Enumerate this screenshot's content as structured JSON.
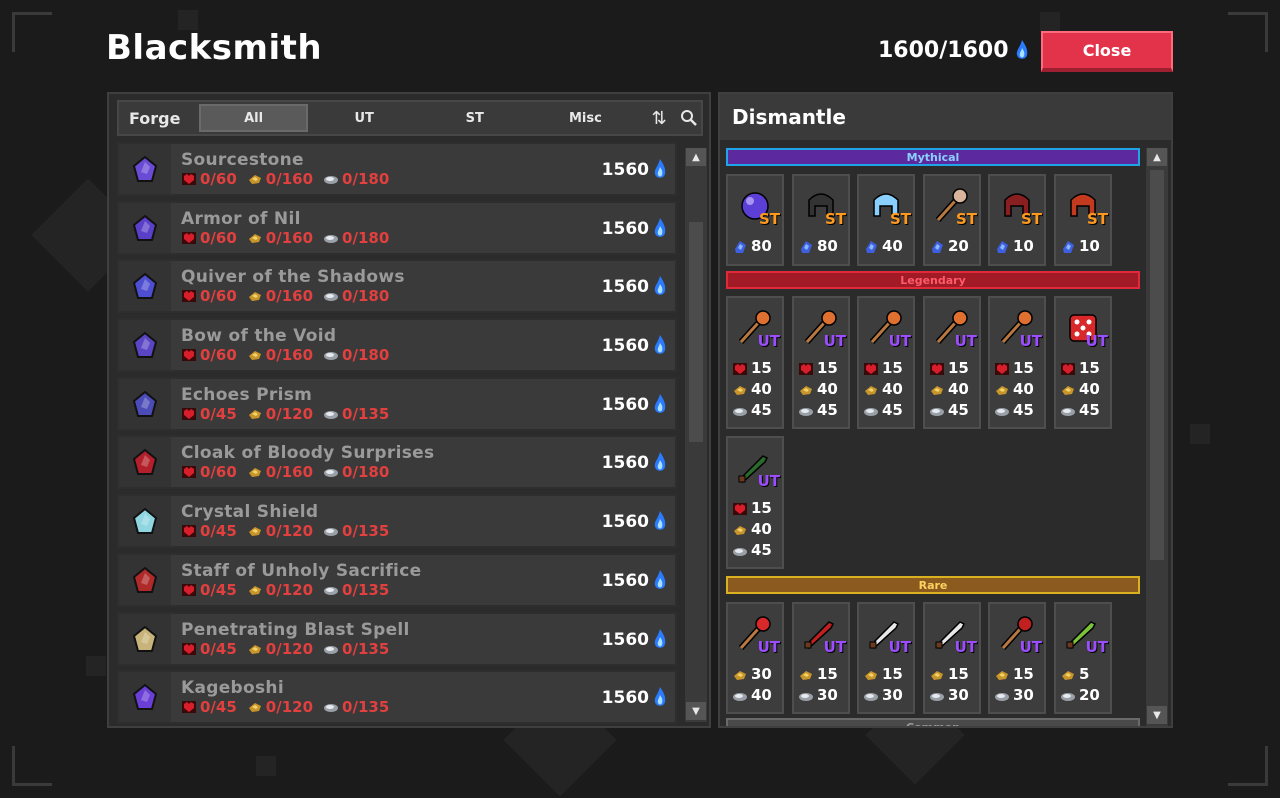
{
  "title": "Blacksmith",
  "essence": {
    "value": "1600/1600"
  },
  "close_label": "Close",
  "forge": {
    "label": "Forge",
    "tabs": [
      {
        "label": "All",
        "active": true
      },
      {
        "label": "UT",
        "active": false
      },
      {
        "label": "ST",
        "active": false
      },
      {
        "label": "Misc",
        "active": false
      }
    ],
    "items": [
      {
        "name": "Sourcestone",
        "c1": "0/60",
        "c2": "0/160",
        "c3": "0/180",
        "price": "1560",
        "icon": "sourcestone-icon",
        "color": "#6a4bd6"
      },
      {
        "name": "Armor of Nil",
        "c1": "0/60",
        "c2": "0/160",
        "c3": "0/180",
        "price": "1560",
        "icon": "armor-icon",
        "color": "#5a3fc9"
      },
      {
        "name": "Quiver of the Shadows",
        "c1": "0/60",
        "c2": "0/160",
        "c3": "0/180",
        "price": "1560",
        "icon": "quiver-icon",
        "color": "#4e4fd0"
      },
      {
        "name": "Bow of the Void",
        "c1": "0/60",
        "c2": "0/160",
        "c3": "0/180",
        "price": "1560",
        "icon": "bow-icon",
        "color": "#5a45c4"
      },
      {
        "name": "Echoes Prism",
        "c1": "0/45",
        "c2": "0/120",
        "c3": "0/135",
        "price": "1560",
        "icon": "prism-icon",
        "color": "#4c4cb8"
      },
      {
        "name": "Cloak of Bloody Surprises",
        "c1": "0/60",
        "c2": "0/160",
        "c3": "0/180",
        "price": "1560",
        "icon": "cloak-icon",
        "color": "#b31f2a"
      },
      {
        "name": "Crystal Shield",
        "c1": "0/45",
        "c2": "0/120",
        "c3": "0/135",
        "price": "1560",
        "icon": "shield-icon",
        "color": "#8fd6e0"
      },
      {
        "name": "Staff of Unholy Sacrifice",
        "c1": "0/45",
        "c2": "0/120",
        "c3": "0/135",
        "price": "1560",
        "icon": "staff-icon",
        "color": "#b02a2a"
      },
      {
        "name": "Penetrating Blast Spell",
        "c1": "0/45",
        "c2": "0/120",
        "c3": "0/135",
        "price": "1560",
        "icon": "spell-icon",
        "color": "#c8b47a"
      },
      {
        "name": "Kageboshi",
        "c1": "0/45",
        "c2": "0/120",
        "c3": "0/135",
        "price": "1560",
        "icon": "kageboshi-icon",
        "color": "#6a3fd6"
      }
    ]
  },
  "dismantle": {
    "label": "Dismantle",
    "sections": {
      "mythical": "Mythical",
      "legendary": "Legendary",
      "rare": "Rare",
      "common": "Common"
    },
    "mythical_items": [
      {
        "tier": "ST",
        "amount": "80",
        "color": "#5b3fd6"
      },
      {
        "tier": "ST",
        "amount": "80",
        "color": "#333333"
      },
      {
        "tier": "ST",
        "amount": "40",
        "color": "#8ad0ff"
      },
      {
        "tier": "ST",
        "amount": "20",
        "color": "#d9b49a"
      },
      {
        "tier": "ST",
        "amount": "10",
        "color": "#8a1f22"
      },
      {
        "tier": "ST",
        "amount": "10",
        "color": "#c43a1f"
      }
    ],
    "legendary_items": [
      {
        "tier": "UT",
        "a": "15",
        "b": "40",
        "c": "45",
        "color": "#e07030"
      },
      {
        "tier": "UT",
        "a": "15",
        "b": "40",
        "c": "45",
        "color": "#e07030"
      },
      {
        "tier": "UT",
        "a": "15",
        "b": "40",
        "c": "45",
        "color": "#e07030"
      },
      {
        "tier": "UT",
        "a": "15",
        "b": "40",
        "c": "45",
        "color": "#e07030"
      },
      {
        "tier": "UT",
        "a": "15",
        "b": "40",
        "c": "45",
        "color": "#e07030"
      },
      {
        "tier": "UT",
        "a": "15",
        "b": "40",
        "c": "45",
        "color": "#d8282a"
      },
      {
        "tier": "UT",
        "a": "15",
        "b": "40",
        "c": "45",
        "color": "#2a6a2a"
      }
    ],
    "rare_items": [
      {
        "tier": "UT",
        "b": "30",
        "c": "40",
        "color": "#d8282a"
      },
      {
        "tier": "UT",
        "b": "15",
        "c": "30",
        "color": "#c02020"
      },
      {
        "tier": "UT",
        "b": "15",
        "c": "30",
        "color": "#e8e8e8"
      },
      {
        "tier": "UT",
        "b": "15",
        "c": "30",
        "color": "#e8e8e8"
      },
      {
        "tier": "UT",
        "b": "15",
        "c": "30",
        "color": "#c02020"
      },
      {
        "tier": "UT",
        "b": "5",
        "c": "20",
        "color": "#7ac23a"
      }
    ]
  }
}
